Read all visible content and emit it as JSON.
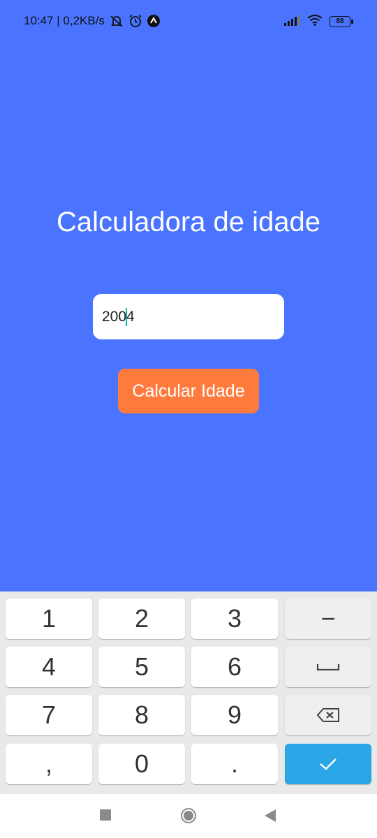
{
  "status_bar": {
    "time_speed": "10:47 | 0,2KB/s",
    "battery": "88"
  },
  "app": {
    "title": "Calculadora de idade",
    "input_value_before_cursor": "200",
    "input_value_after_cursor": "4",
    "button_label": "Calcular Idade"
  },
  "keyboard": {
    "keys": [
      "1",
      "2",
      "3",
      "4",
      "5",
      "6",
      "7",
      "8",
      "9",
      ",",
      "0",
      "."
    ],
    "minus_label": "−"
  },
  "colors": {
    "background": "#4a74ff",
    "button": "#ff7a3d",
    "confirm_key": "#2aa6e6"
  },
  "icons": [
    "mute-icon",
    "alarm-icon",
    "app-notification-icon",
    "signal-icon",
    "wifi-icon",
    "battery-icon",
    "space-icon",
    "backspace-icon",
    "check-icon",
    "recents-icon",
    "home-icon",
    "back-icon"
  ]
}
